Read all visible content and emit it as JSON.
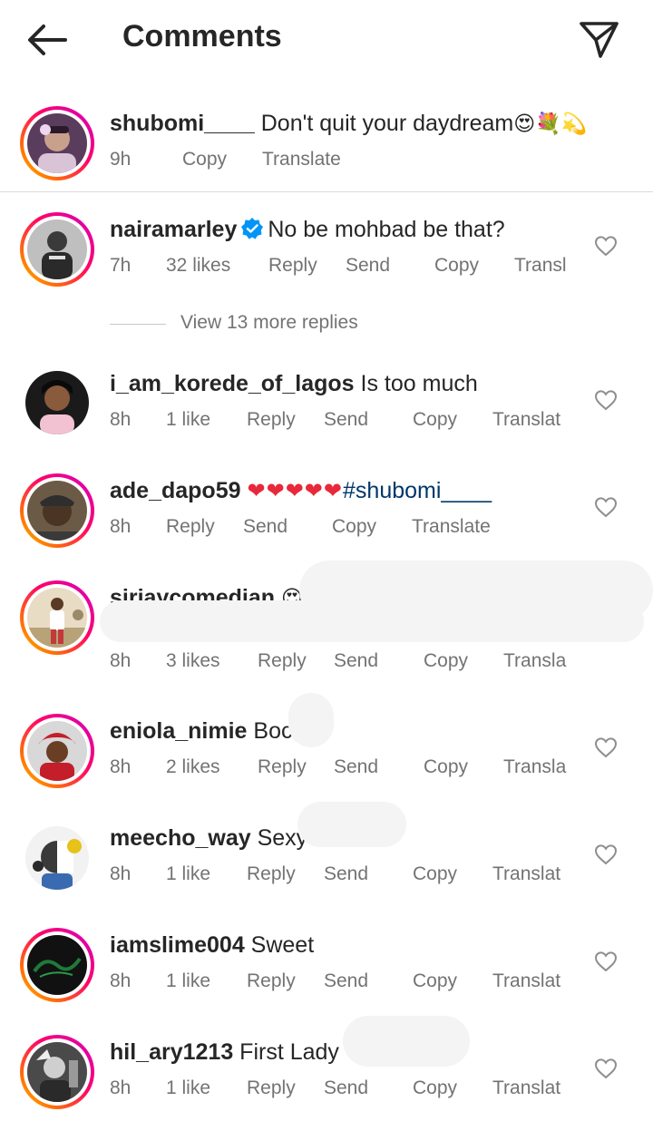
{
  "header": {
    "title": "Comments"
  },
  "caption": {
    "username": "shubomi____",
    "text": "Don't quit your daydream",
    "emojis": "😍💐💫",
    "time": "9h",
    "copy": "Copy",
    "translate": "Translate"
  },
  "view_replies": "View 13 more replies",
  "comments": [
    {
      "username": "nairamarley",
      "verified": true,
      "text": "No be mohbad be that?",
      "time": "7h",
      "likes": "32 likes",
      "reply": "Reply",
      "send": "Send",
      "copy": "Copy",
      "translate": "Transl"
    },
    {
      "username": "i_am_korede_of_lagos",
      "text": "Is too much",
      "time": "8h",
      "likes": "1 like",
      "reply": "Reply",
      "send": "Send",
      "copy": "Copy",
      "translate": "Translat"
    },
    {
      "username": "ade_dapo59",
      "hearts": "❤❤❤❤❤",
      "hashtag": "#shubomi____",
      "time": "8h",
      "reply": "Reply",
      "send": "Send",
      "copy": "Copy",
      "translate": "Translate"
    },
    {
      "username": "sirjaycomedian",
      "emoji": "😍",
      "time": "8h",
      "likes": "3 likes",
      "reply": "Reply",
      "send": "Send",
      "copy": "Copy",
      "translate": "Transla"
    },
    {
      "username": "eniola_nimie",
      "text": "Boc",
      "time": "8h",
      "likes": "2 likes",
      "reply": "Reply",
      "send": "Send",
      "copy": "Copy",
      "translate": "Transla"
    },
    {
      "username": "meecho_way",
      "text": "Sexy",
      "time": "8h",
      "likes": "1 like",
      "reply": "Reply",
      "send": "Send",
      "copy": "Copy",
      "translate": "Translat"
    },
    {
      "username": "iamslime004",
      "text": "Sweet",
      "time": "8h",
      "likes": "1 like",
      "reply": "Reply",
      "send": "Send",
      "copy": "Copy",
      "translate": "Translat"
    },
    {
      "username": "hil_ary1213",
      "text": "First Lady",
      "time": "8h",
      "likes": "1 like",
      "reply": "Reply",
      "send": "Send",
      "copy": "Copy",
      "translate": "Translat"
    }
  ],
  "icons": {
    "back": "arrow-left-icon",
    "share": "paper-plane-icon",
    "like": "heart-outline-icon",
    "verified": "verified-badge-icon"
  },
  "colors": {
    "text": "#262626",
    "muted": "#737373",
    "hashtag": "#00376b",
    "verified": "#0095f6",
    "divider": "#dbdbdb"
  }
}
